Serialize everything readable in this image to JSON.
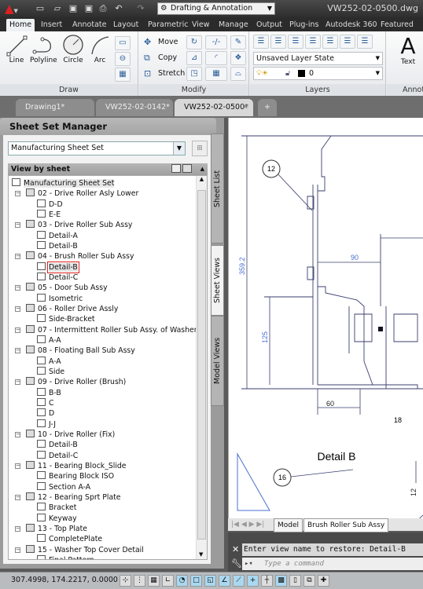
{
  "app": {
    "title": "VW252-02-0500.dwg",
    "workspace": "Drafting & Annotation"
  },
  "quick_access": [
    "new-icon",
    "open-icon",
    "save-icon",
    "save-as-icon",
    "plot-icon",
    "undo-icon",
    "redo-icon"
  ],
  "ribbon": {
    "tabs": [
      "Home",
      "Insert",
      "Annotate",
      "Layout",
      "Parametric",
      "View",
      "Manage",
      "Output",
      "Plug-ins",
      "Autodesk 360",
      "Featured"
    ],
    "active_tab": "Home",
    "draw": {
      "title": "Draw",
      "line": "Line",
      "polyline": "Polyline",
      "circle": "Circle",
      "arc": "Arc"
    },
    "modify": {
      "title": "Modify",
      "move": "Move",
      "copy": "Copy",
      "stretch": "Stretch"
    },
    "layers": {
      "title": "Layers",
      "layer_state": "Unsaved Layer State",
      "current_layer": "0"
    },
    "annotation": {
      "title": "Annot",
      "text": "Text"
    }
  },
  "doc_tabs": [
    {
      "label": "Drawing1*"
    },
    {
      "label": "VW252-02-0142*"
    },
    {
      "label": "VW252-02-0500*",
      "active": true
    }
  ],
  "sheet_set_manager": {
    "title": "Sheet Set Manager",
    "selected_set": "Manufacturing Sheet Set",
    "view_header": "View by sheet",
    "side_tabs": [
      "Sheet List",
      "Sheet Views",
      "Model Views"
    ],
    "active_side_tab": "Sheet Views",
    "tree": [
      {
        "label": "Manufacturing Sheet Set",
        "level": 0,
        "type": "set"
      },
      {
        "label": "02 - Drive Roller Asly Lower",
        "level": 1,
        "type": "sheet"
      },
      {
        "label": "D-D",
        "level": 2,
        "type": "view"
      },
      {
        "label": "E-E",
        "level": 2,
        "type": "view"
      },
      {
        "label": "03 - Drive Roller Sub Assy",
        "level": 1,
        "type": "sheet"
      },
      {
        "label": "Detail-A",
        "level": 2,
        "type": "view"
      },
      {
        "label": "Detail-B",
        "level": 2,
        "type": "view"
      },
      {
        "label": "04 - Brush Roller Sub Assy",
        "level": 1,
        "type": "sheet"
      },
      {
        "label": "Detail-B",
        "level": 2,
        "type": "view",
        "selected": true
      },
      {
        "label": "Detail-C",
        "level": 2,
        "type": "view"
      },
      {
        "label": "05 - Door Sub Assy",
        "level": 1,
        "type": "sheet"
      },
      {
        "label": "Isometric",
        "level": 2,
        "type": "view"
      },
      {
        "label": "06 - Roller Drive Assly",
        "level": 1,
        "type": "sheet"
      },
      {
        "label": "Side-Bracket",
        "level": 2,
        "type": "view"
      },
      {
        "label": "07 - Intermittent Roller Sub Assy. of Washer",
        "level": 1,
        "type": "sheet"
      },
      {
        "label": "A-A",
        "level": 2,
        "type": "view"
      },
      {
        "label": "08 - Floating Ball Sub Assy",
        "level": 1,
        "type": "sheet"
      },
      {
        "label": "A-A",
        "level": 2,
        "type": "view"
      },
      {
        "label": "Side",
        "level": 2,
        "type": "view"
      },
      {
        "label": "09 - Drive Roller (Brush)",
        "level": 1,
        "type": "sheet"
      },
      {
        "label": "B-B",
        "level": 2,
        "type": "view"
      },
      {
        "label": "C",
        "level": 2,
        "type": "view"
      },
      {
        "label": "D",
        "level": 2,
        "type": "view"
      },
      {
        "label": "J-J",
        "level": 2,
        "type": "view"
      },
      {
        "label": "10 - Drive Roller (Fix)",
        "level": 1,
        "type": "sheet"
      },
      {
        "label": "Detail-B",
        "level": 2,
        "type": "view"
      },
      {
        "label": "Detail-C",
        "level": 2,
        "type": "view"
      },
      {
        "label": "11 - Bearing Block_Slide",
        "level": 1,
        "type": "sheet"
      },
      {
        "label": "Bearing Block ISO",
        "level": 2,
        "type": "view"
      },
      {
        "label": "Section A-A",
        "level": 2,
        "type": "view"
      },
      {
        "label": "12 - Bearing Sprt Plate",
        "level": 1,
        "type": "sheet"
      },
      {
        "label": "Bracket",
        "level": 2,
        "type": "view"
      },
      {
        "label": "Keyway",
        "level": 2,
        "type": "view"
      },
      {
        "label": "13 - Top Plate",
        "level": 1,
        "type": "sheet"
      },
      {
        "label": "CompletePlate",
        "level": 2,
        "type": "view"
      },
      {
        "label": "15 - Washer Top Cover Detail",
        "level": 1,
        "type": "sheet"
      },
      {
        "label": "Final Pattern",
        "level": 2,
        "type": "view"
      }
    ]
  },
  "drawing": {
    "title": "Detail B",
    "dimensions": {
      "d1": "359.2",
      "d2": "90",
      "d3": "125",
      "d4": "60",
      "d5": "12"
    },
    "balloons": {
      "b1": "12",
      "b2": "16",
      "b3": "18"
    },
    "line_color": "#3a3f6e",
    "dim_color": "#4a6fd0"
  },
  "layout_tabs": {
    "model": "Model",
    "layout": "Brush Roller Sub Assy"
  },
  "command": {
    "history": "Enter view name to restore: Detail-B",
    "placeholder": "Type a command"
  },
  "status": {
    "coordinates": "307.4998, 174.2217, 0.0000"
  }
}
